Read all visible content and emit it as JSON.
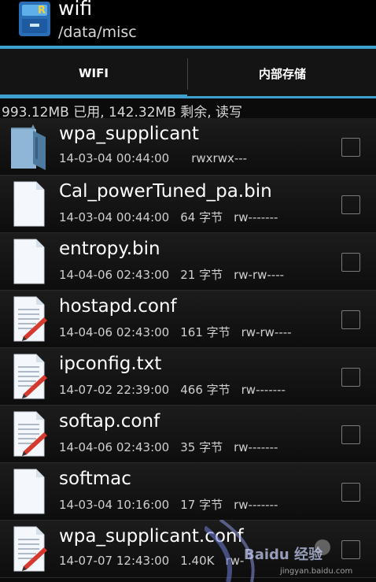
{
  "header": {
    "title": "wifi",
    "path": "/data/misc"
  },
  "tabs": [
    {
      "label": "WIFI",
      "active": true
    },
    {
      "label": "内部存储",
      "active": false
    }
  ],
  "storage_info": "993.12MB 已用, 142.32MB 剩余, 读写",
  "files": [
    {
      "name": "wpa_supplicant",
      "date": "14-03-04 00:44:00",
      "size": "",
      "perms": "rwxrwx---",
      "icon": "folder-icon"
    },
    {
      "name": "Cal_powerTuned_pa.bin",
      "date": "14-03-04 00:44:00",
      "size": "64 字节",
      "perms": "rw-------",
      "icon": "file-icon"
    },
    {
      "name": "entropy.bin",
      "date": "14-04-06 02:43:00",
      "size": "21 字节",
      "perms": "rw-rw----",
      "icon": "file-icon"
    },
    {
      "name": "hostapd.conf",
      "date": "14-04-06 02:43:00",
      "size": "161 字节",
      "perms": "rw-rw----",
      "icon": "text-file-icon"
    },
    {
      "name": "ipconfig.txt",
      "date": "14-07-02 22:39:00",
      "size": "466 字节",
      "perms": "rw-------",
      "icon": "text-file-icon"
    },
    {
      "name": "softap.conf",
      "date": "14-04-06 02:43:00",
      "size": "35 字节",
      "perms": "rw-------",
      "icon": "text-file-icon"
    },
    {
      "name": "softmac",
      "date": "14-03-04 10:16:00",
      "size": "17 字节",
      "perms": "rw-------",
      "icon": "file-icon"
    },
    {
      "name": "wpa_supplicant.conf",
      "date": "14-07-07 12:43:00",
      "size": "1.40K",
      "perms": "rw-",
      "icon": "text-file-icon"
    }
  ],
  "watermark": {
    "text": "Baidu 经验",
    "url_text": "jingyan.baidu.com"
  },
  "colors": {
    "accent": "#3ea0cf"
  }
}
